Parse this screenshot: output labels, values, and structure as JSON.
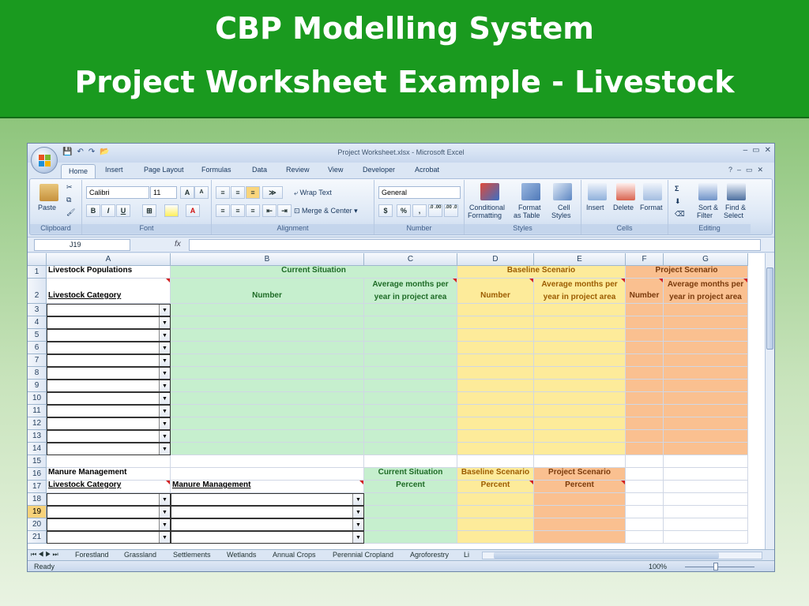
{
  "slide": {
    "title_line1": "CBP Modelling System",
    "title_line2": "Project Worksheet Example - Livestock"
  },
  "window": {
    "title": "Project Worksheet.xlsx - Microsoft Excel"
  },
  "ribbon": {
    "tabs": [
      "Home",
      "Insert",
      "Page Layout",
      "Formulas",
      "Data",
      "Review",
      "View",
      "Developer",
      "Acrobat"
    ],
    "clipboard": {
      "paste": "Paste",
      "label": "Clipboard"
    },
    "font": {
      "name": "Calibri",
      "size": "11",
      "bold": "B",
      "italic": "I",
      "underline": "U",
      "grow": "A",
      "shrink": "A",
      "label": "Font"
    },
    "alignment": {
      "wrap": "Wrap Text",
      "merge": "Merge & Center",
      "label": "Alignment"
    },
    "number": {
      "format": "General",
      "currency": "$",
      "percent": "%",
      "comma": ",",
      "inc": ".0 .00",
      "dec": ".00 .0",
      "label": "Number"
    },
    "styles": {
      "cond1": "Conditional",
      "cond2": "Formatting",
      "fmt1": "Format",
      "fmt2": "as Table",
      "cell1": "Cell",
      "cell2": "Styles",
      "label": "Styles"
    },
    "cells": {
      "insert": "Insert",
      "delete": "Delete",
      "format": "Format",
      "label": "Cells"
    },
    "editing": {
      "sigma": "Σ",
      "sort1": "Sort &",
      "sort2": "Filter",
      "find1": "Find &",
      "find2": "Select",
      "label": "Editing"
    }
  },
  "formula_bar": {
    "name_box": "J19",
    "fx": "fx"
  },
  "grid": {
    "columns": [
      "A",
      "B",
      "C",
      "D",
      "E",
      "F",
      "G"
    ],
    "rows": [
      "1",
      "2",
      "3",
      "4",
      "5",
      "6",
      "7",
      "8",
      "9",
      "10",
      "11",
      "12",
      "13",
      "14",
      "15",
      "16",
      "17",
      "18",
      "19",
      "20",
      "21"
    ],
    "selected_row": "19",
    "a1": "Livestock Populations",
    "current_situation": "Current Situation",
    "baseline_scenario": "Baseline Scenario",
    "project_scenario": "Project Scenario",
    "livestock_category": "Livestock Category",
    "number": "Number",
    "avg_months": "Average months per year in project area",
    "manure_management": "Manure Management",
    "percent": "Percent",
    "dropdown_arrow": "▼"
  },
  "sheet_tabs": [
    "Forestland",
    "Grassland",
    "Settlements",
    "Wetlands",
    "Annual Crops",
    "Perennial Cropland",
    "Agroforestry",
    "Li"
  ],
  "status": {
    "ready": "Ready",
    "zoom": "100%"
  },
  "colors": {
    "banner": "#1a9a1f",
    "green": "#c6efce",
    "yellow": "#fdeb9a",
    "orange": "#fac090"
  }
}
